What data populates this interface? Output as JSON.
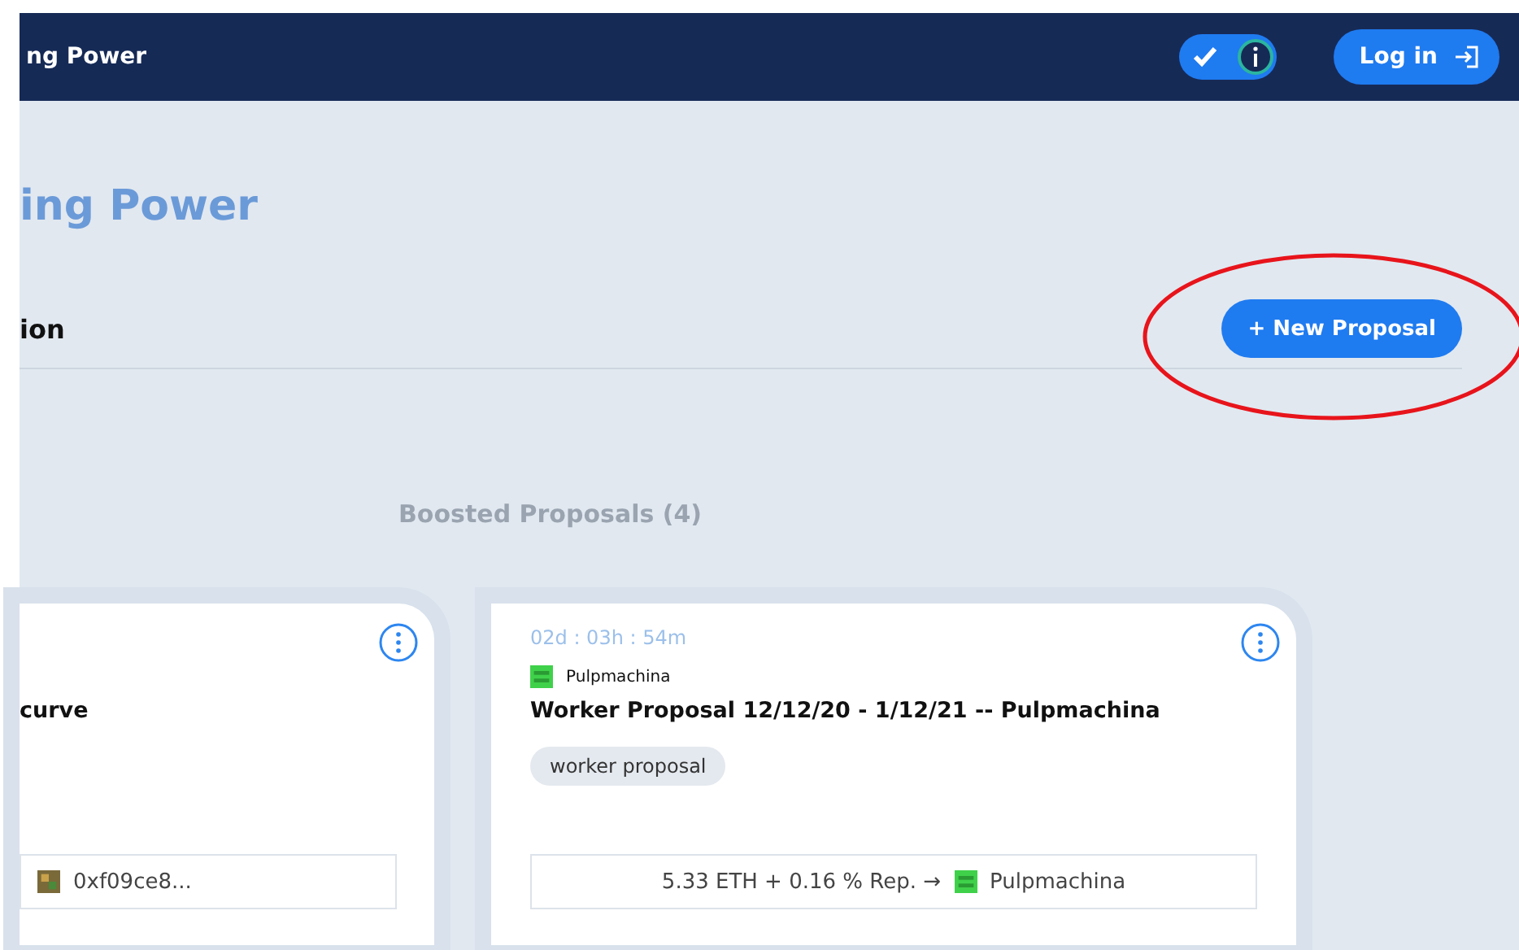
{
  "header": {
    "title": "ng Power",
    "toggle": {
      "on": true
    },
    "login_button": "Log in"
  },
  "page": {
    "title": "ing Power",
    "section_title": "ion",
    "new_proposal_button": "+ New Proposal",
    "highlighted": true
  },
  "boosted": {
    "heading": "Boosted Proposals (4)"
  },
  "cards": [
    {
      "kind": "cut",
      "title": "curve",
      "recipient": "0xf09ce8..."
    },
    {
      "kind": "full",
      "timer": "02d : 03h : 54m",
      "proposer": "Pulpmachina",
      "title": "Worker Proposal 12/12/20 - 1/12/21 -- Pulpmachina",
      "tag": "worker proposal",
      "reward": "5.33 ETH + 0.16 % Rep. →",
      "recipient": "Pulpmachina"
    }
  ]
}
